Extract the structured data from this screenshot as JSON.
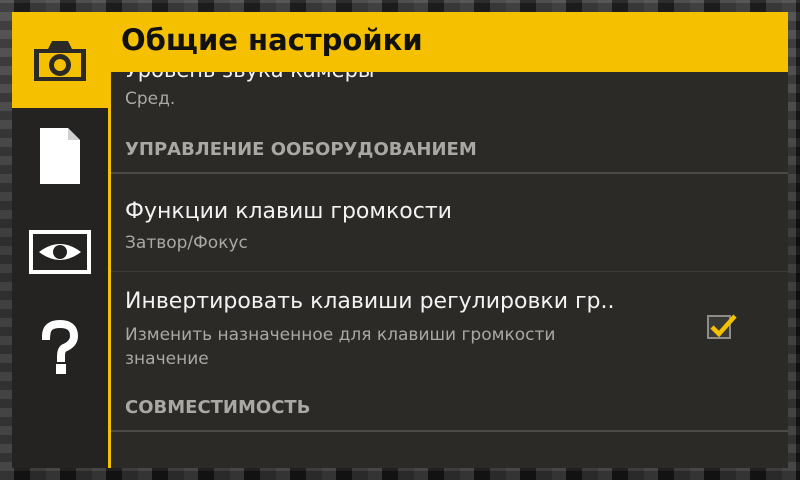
{
  "header": {
    "title": "Общие настройки"
  },
  "sidebar": {
    "items": [
      {
        "icon": "camera-icon",
        "active": true
      },
      {
        "icon": "document-icon",
        "active": false
      },
      {
        "icon": "eye-icon",
        "active": false
      },
      {
        "icon": "help-icon",
        "active": false
      }
    ]
  },
  "list": {
    "clipped_item": {
      "title": "Уровень звука камеры",
      "summary": "Сред."
    },
    "category_hardware": "УПРАВЛЕНИЕ ООБОРУДОВАНИЕМ",
    "volume_keys": {
      "title": "Функции клавиш громкости",
      "summary": "Затвор/Фокус"
    },
    "invert_keys": {
      "title": "Инвертировать клавиши регулировки гр..",
      "summary_line1": "Изменить назначенное для клавиши громкости",
      "summary_line2": "значение",
      "checked": true
    },
    "category_compat": "СОВМЕСТИМОСТЬ"
  },
  "colors": {
    "accent": "#f4c000",
    "panel_bg": "#2b2a27",
    "sidebar_bg": "#242321",
    "title_text": "#f2f2f2",
    "summary_text": "#a9a8a3"
  }
}
